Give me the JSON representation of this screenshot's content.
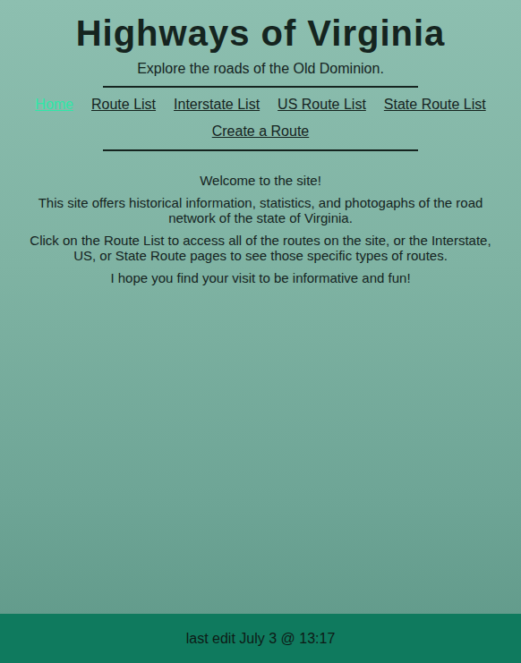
{
  "header": {
    "title": "Highways of Virginia",
    "subtitle": "Explore the roads of the Old Dominion."
  },
  "nav": [
    {
      "label": "Home",
      "selected": true
    },
    {
      "label": "Route List",
      "selected": false
    },
    {
      "label": "Interstate List",
      "selected": false
    },
    {
      "label": "US Route List",
      "selected": false
    },
    {
      "label": "State Route List",
      "selected": false
    },
    {
      "label": "Create a Route",
      "selected": false
    }
  ],
  "content": [
    "Welcome to the site!",
    "This site offers historical information, statistics, and photogaphs of the road network of the state of Virginia.",
    "Click on the Route List to access all of the routes on the site, or the Interstate, US, or State Route pages to see those specific types of routes.",
    "I hope you find your visit to be informative and fun!"
  ],
  "footer": {
    "text": "last edit July 3 @ 13:17"
  }
}
